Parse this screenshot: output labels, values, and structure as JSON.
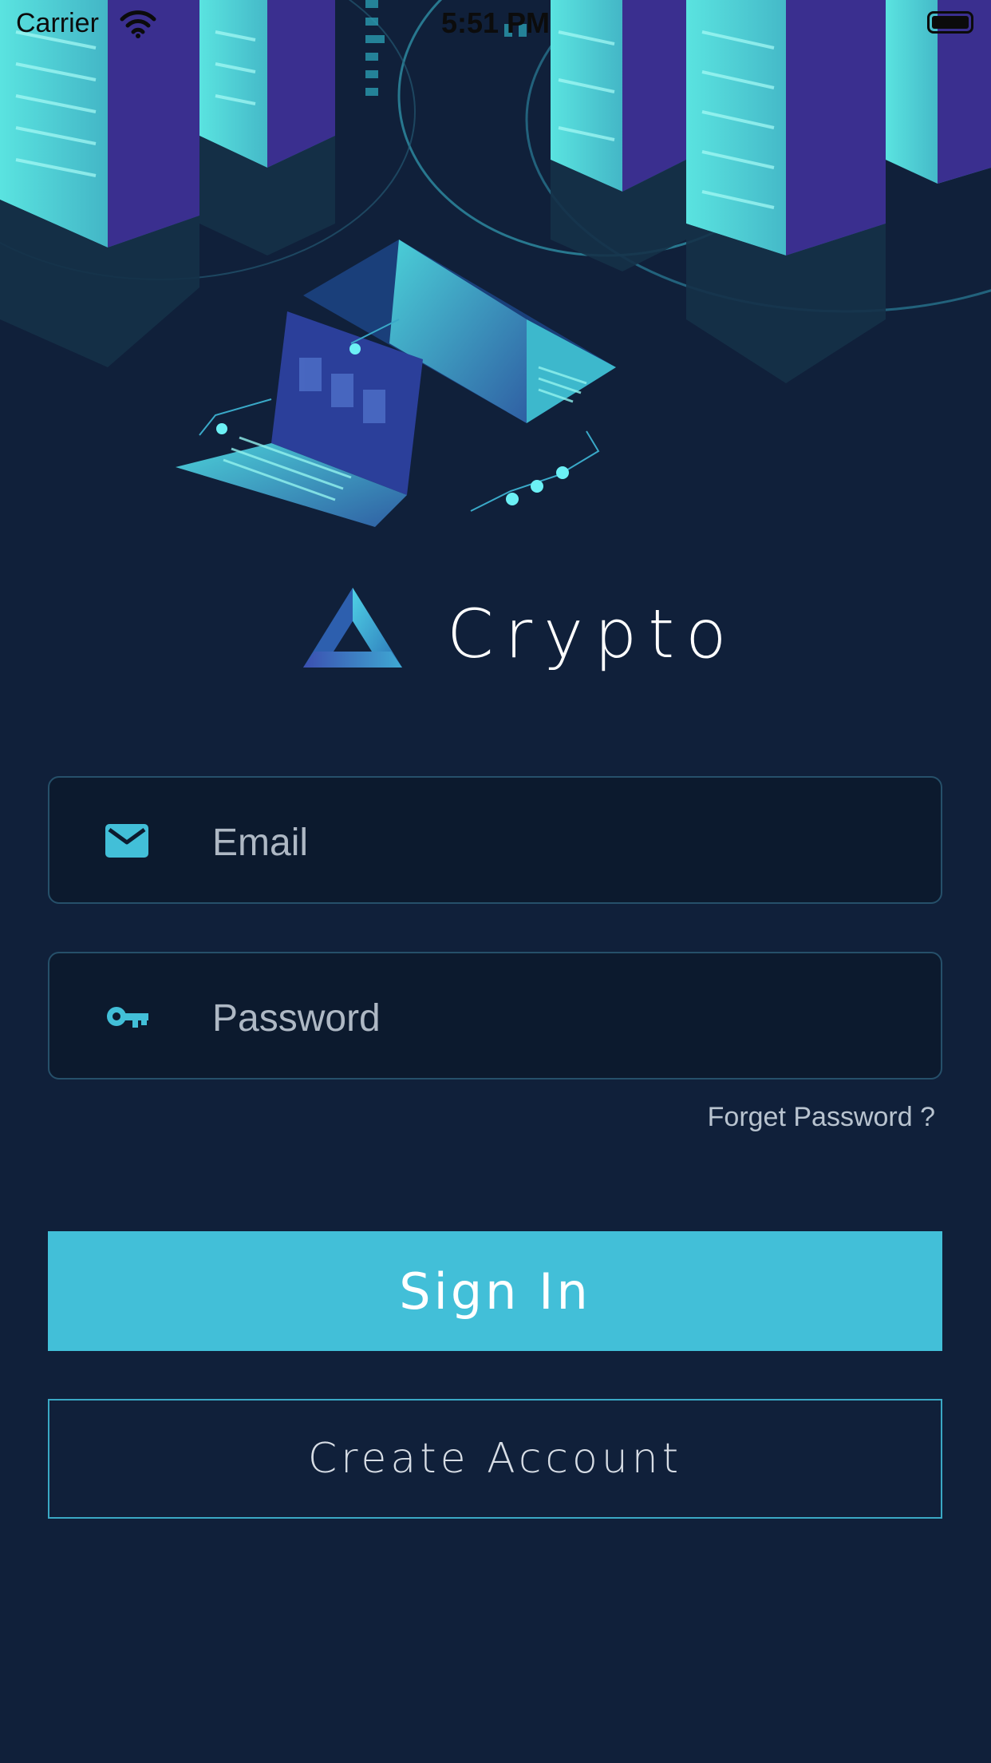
{
  "status_bar": {
    "carrier": "Carrier",
    "time": "5:51 PM"
  },
  "brand": {
    "name": "Crypto"
  },
  "form": {
    "email_placeholder": "Email",
    "password_placeholder": "Password",
    "forgot_label": "Forget Password ?",
    "signin_label": "Sign In",
    "create_label": "Create Account"
  },
  "colors": {
    "background": "#10203a",
    "accent": "#42bfd8",
    "field_bg": "#0c1a2e",
    "field_border": "#26506a"
  },
  "icons": [
    "wifi-icon",
    "battery-icon",
    "app-logo-icon",
    "mail-icon",
    "key-icon"
  ]
}
